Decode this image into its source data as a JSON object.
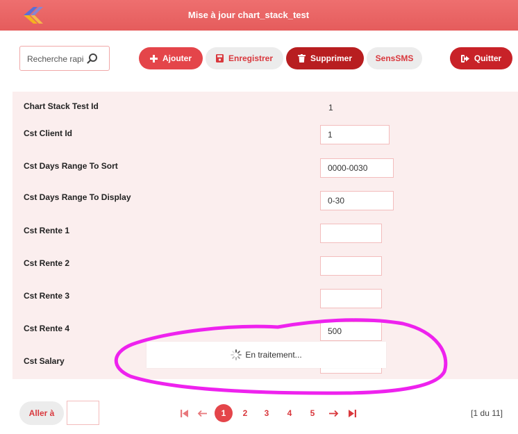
{
  "window": {
    "title": "Mise à jour chart_stack_test"
  },
  "toolbar": {
    "search_placeholder": "Recherche rapide",
    "add_label": "Ajouter",
    "save_label": "Enregistrer",
    "delete_label": "Supprimer",
    "sms_label": "SensSMS",
    "quit_label": "Quitter"
  },
  "form": {
    "fields": [
      {
        "label": "Chart Stack Test Id",
        "value": "1"
      },
      {
        "label": "Cst Client Id",
        "value": "1"
      },
      {
        "label": "Cst Days Range To Sort",
        "value": "0000-0030"
      },
      {
        "label": "Cst Days Range To Display",
        "value": "0-30"
      },
      {
        "label": "Cst Rente 1",
        "value": ""
      },
      {
        "label": "Cst Rente 2",
        "value": ""
      },
      {
        "label": "Cst Rente 3",
        "value": ""
      },
      {
        "label": "Cst Rente 4",
        "value": "500"
      },
      {
        "label": "Cst Salary",
        "value": ""
      }
    ]
  },
  "loading": {
    "text": "En traitement..."
  },
  "pagination": {
    "goto_label": "Aller à",
    "goto_value": "",
    "pages": [
      "1",
      "2",
      "3",
      "4",
      "5"
    ],
    "current_page": "1",
    "counter": "[1 du 11]"
  },
  "colors": {
    "brand_red": "#e4454a",
    "dark_red": "#b81e20",
    "form_bg": "#fbeeee",
    "annotation": "#ee22ee"
  }
}
